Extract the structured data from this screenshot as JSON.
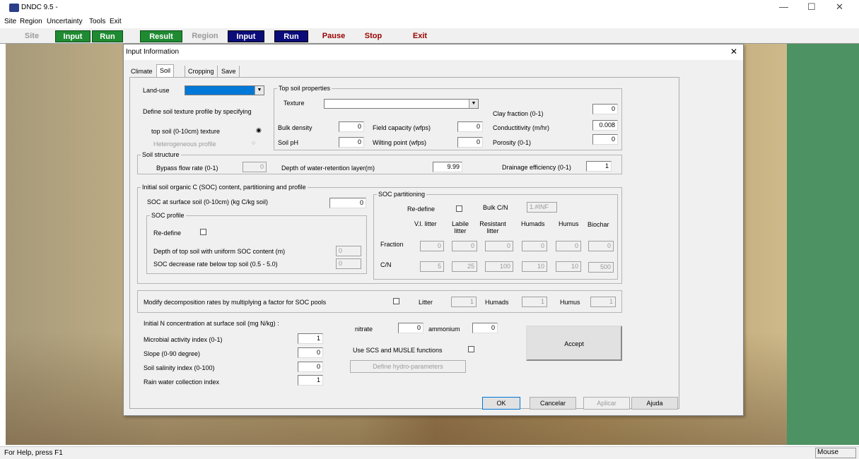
{
  "window": {
    "title": "DNDC 9.5 -",
    "min": "—",
    "max": "☐",
    "close": "✕"
  },
  "menu": [
    "Site",
    "Region",
    "Uncertainty",
    "Tools",
    "Exit"
  ],
  "toolbar": {
    "site": "Site",
    "input1": "Input",
    "run1": "Run",
    "result": "Result",
    "region": "Region",
    "input2": "Input",
    "run2": "Run",
    "pause": "Pause",
    "stop": "Stop",
    "exit": "Exit"
  },
  "status": {
    "help": "For Help, press F1",
    "mouse": "Mouse"
  },
  "dialog": {
    "title": "Input Information",
    "close": "✕",
    "tabs": [
      "Climate",
      "Soil",
      "Cropping",
      "Save"
    ],
    "landuse_label": "Land-use",
    "define_texture": "Define soil texture profile by specifying",
    "topsoil_texture": "top soil (0-10cm) texture",
    "hetero_profile": "Heterogeneous profile",
    "top_soil": {
      "title": "Top soil properties",
      "texture": "Texture",
      "clay_label": "Clay fraction (0-1)",
      "clay": "0",
      "bulk_label": "Bulk density",
      "bulk": "0",
      "field_label": "Field capacity (wfps)",
      "field": "0",
      "cond_label": "Conductitivity (m/hr)",
      "cond": "0.008",
      "ph_label": "Soil pH",
      "ph": "0",
      "wilt_label": "Wilting point (wfps)",
      "wilt": "0",
      "por_label": "Porosity (0-1)",
      "por": "0"
    },
    "structure": {
      "title": "Soil structure",
      "bypass_label": "Bypass flow rate (0-1)",
      "bypass": "0",
      "depth_label": "Depth of water-retention layer(m)",
      "depth": "9.99",
      "drain_label": "Drainage efficiency (0-1)",
      "drain": "1"
    },
    "soc": {
      "title": "Initial soil organic C (SOC) content, partitioning and profile",
      "surface_label": "SOC at surface soil (0-10cm) (kg C/kg soil)",
      "surface": "0",
      "profile_title": "SOC profile",
      "redefine": "Re-define",
      "depth_label": "Depth of top soil with uniform SOC content (m)",
      "depth": "0",
      "rate_label": "SOC decrease rate below top soil (0.5 - 5.0)",
      "rate": "0",
      "part_title": "SOC partitioning",
      "part_redefine": "Re-define",
      "bulk_cn_label": "Bulk C/N",
      "bulk_cn": "1.#INF",
      "headers": [
        "V.l. litter",
        "Labile litter",
        "Resistant litter",
        "Humads",
        "Humus",
        "Biochar"
      ],
      "fraction_label": "Fraction",
      "fraction": [
        "0",
        "0",
        "0",
        "0",
        "0",
        "0"
      ],
      "cn_label": "C/N",
      "cn": [
        "5",
        "25",
        "100",
        "10",
        "10",
        "500"
      ]
    },
    "decomp": {
      "label": "Modify decomposition rates by multiplying a factor for SOC pools",
      "litter_label": "Litter",
      "litter": "1",
      "humads_label": "Humads",
      "humads": "1",
      "humus_label": "Humus",
      "humus": "1"
    },
    "n": {
      "title": "Initial N concentration at surface soil (mg N/kg) :",
      "nitrate_label": "nitrate",
      "nitrate": "0",
      "ammonium_label": "ammonium",
      "ammonium": "0"
    },
    "micro_label": "Microbial activity index (0-1)",
    "micro": "1",
    "slope_label": "Slope (0-90 degree)",
    "slope": "0",
    "salinity_label": "Soil salinity index (0-100)",
    "salinity": "0",
    "rain_label": "Rain water collection index",
    "rain": "1",
    "scs_label": "Use SCS and MUSLE functions",
    "hydro_btn": "Define hydro-parameters",
    "accept": "Accept",
    "ok": "OK",
    "cancel": "Cancelar",
    "apply": "Aplicar",
    "help": "Ajuda"
  }
}
